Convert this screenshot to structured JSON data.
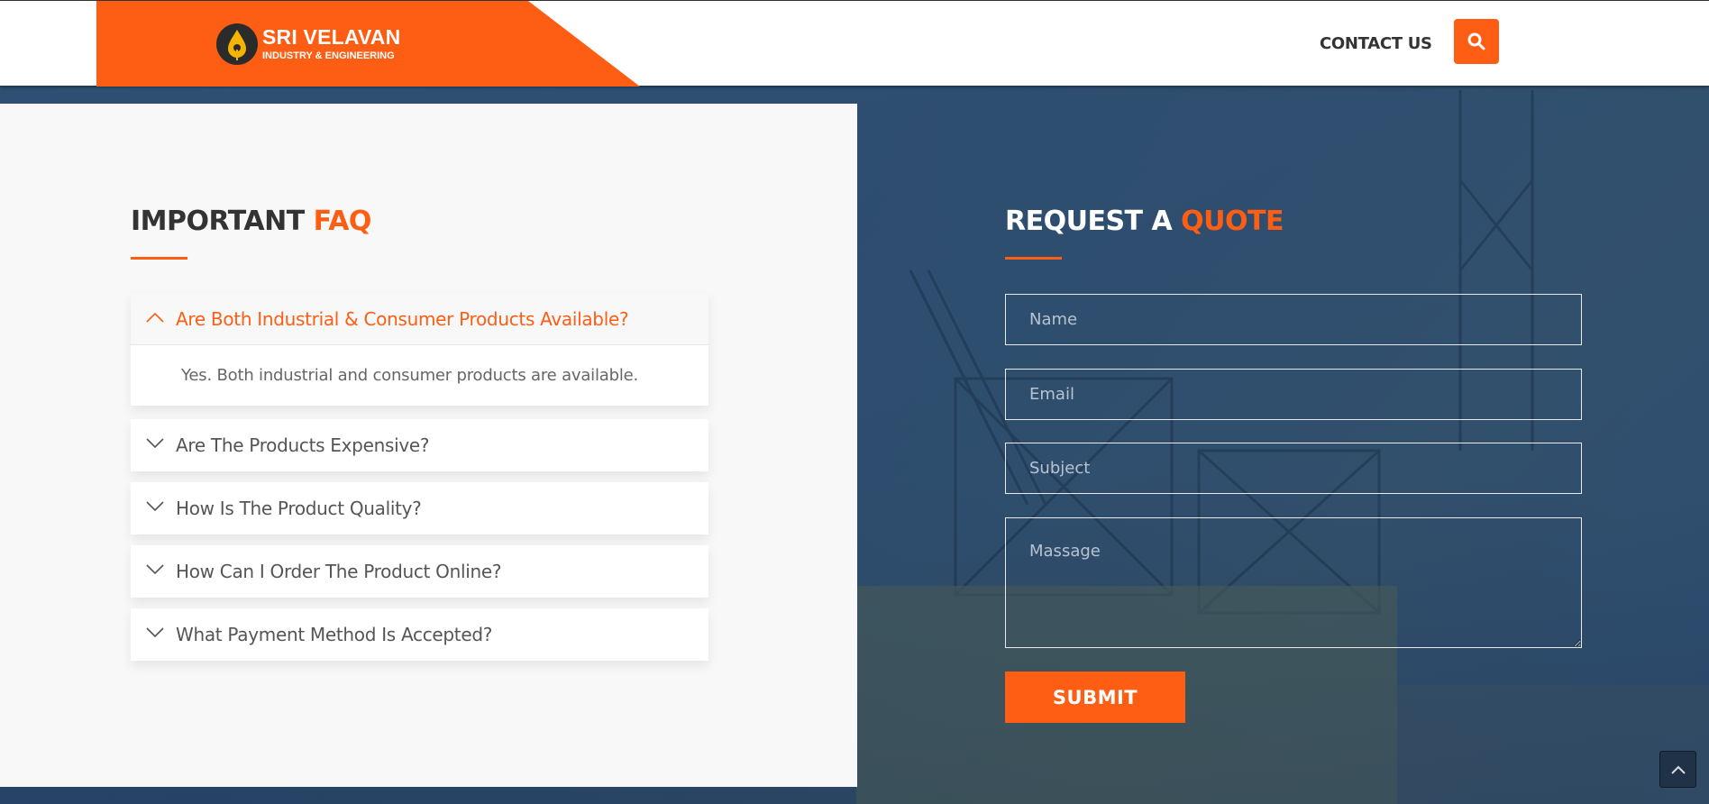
{
  "header": {
    "brand_name": "SRI VELAVAN",
    "brand_sub": "INDUSTRY & ENGINEERING",
    "nav_contact": "CONTACT US",
    "search_icon": "search-icon",
    "brand_color": "#fd5e14"
  },
  "faq": {
    "title_main": "IMPORTANT",
    "title_accent": "FAQ",
    "items": [
      {
        "question": "Are Both Industrial & Consumer Products Available?",
        "answer": "Yes. Both industrial and consumer products are available.",
        "open": true
      },
      {
        "question": "Are The Products Expensive?",
        "open": false
      },
      {
        "question": "How Is The Product Quality?",
        "open": false
      },
      {
        "question": "How Can I Order The Product Online?",
        "open": false
      },
      {
        "question": "What Payment Method Is Accepted?",
        "open": false
      }
    ]
  },
  "quote": {
    "title_main": "REQUEST A",
    "title_accent": "QUOTE",
    "name_placeholder": "Name",
    "email_placeholder": "Email",
    "subject_placeholder": "Subject",
    "message_placeholder": "Massage",
    "submit_label": "SUBMIT"
  },
  "scroll_top_icon": "chevron-up-icon"
}
